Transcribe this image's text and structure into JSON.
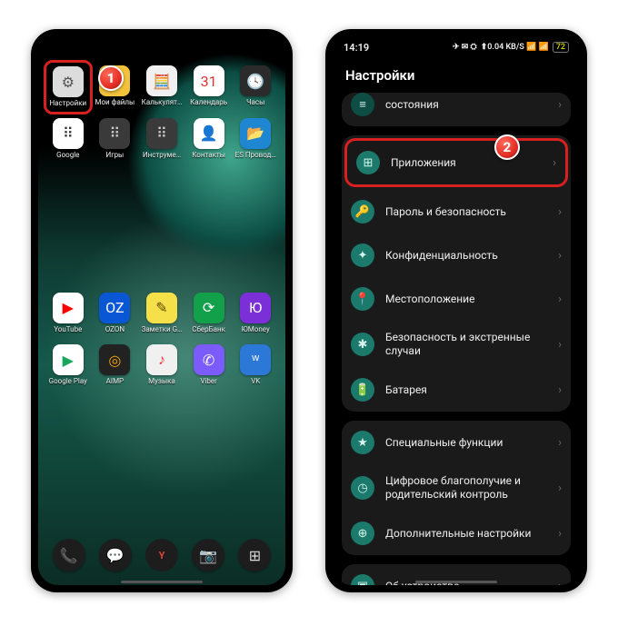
{
  "status": {
    "time": "14:19",
    "battery": "72"
  },
  "badges": {
    "one": "1",
    "two": "2"
  },
  "drawer": {
    "row1": [
      {
        "name": "settings-app",
        "label": "Настройки",
        "icon": "⚙",
        "cls": "ic-gear",
        "hi": true
      },
      {
        "name": "files-app",
        "label": "Мои файлы",
        "icon": "📁",
        "cls": "ic-folder"
      },
      {
        "name": "calculator-app",
        "label": "Калькулят…",
        "icon": "🧮",
        "cls": "ic-calc"
      },
      {
        "name": "calendar-app",
        "label": "Календарь",
        "icon": "31",
        "cls": "ic-cal"
      },
      {
        "name": "clock-app",
        "label": "Часы",
        "icon": "🕓",
        "cls": "ic-clock"
      }
    ],
    "row2": [
      {
        "name": "google-folder",
        "label": "Google",
        "icon": "⠿",
        "cls": "ic-google"
      },
      {
        "name": "games-folder",
        "label": "Игры",
        "icon": "⠿",
        "cls": "ic-games"
      },
      {
        "name": "tools-folder",
        "label": "Инструме…",
        "icon": "⠿",
        "cls": "ic-tools"
      },
      {
        "name": "contacts-app",
        "label": "Контакты",
        "icon": "👤",
        "cls": "ic-contacts"
      },
      {
        "name": "es-explorer-app",
        "label": "ES Провод…",
        "icon": "📂",
        "cls": "ic-es"
      }
    ],
    "row3": [
      {
        "name": "youtube-app",
        "label": "YouTube",
        "icon": "▶",
        "cls": "ic-yt"
      },
      {
        "name": "ozon-app",
        "label": "OZON",
        "icon": "OZ",
        "cls": "ic-ozon"
      },
      {
        "name": "gnotes-app",
        "label": "Заметки G…",
        "icon": "✎",
        "cls": "ic-notes"
      },
      {
        "name": "sberbank-app",
        "label": "СберБанк",
        "icon": "⟳",
        "cls": "ic-sber"
      },
      {
        "name": "yoomoney-app",
        "label": "ЮMoney",
        "icon": "Ю",
        "cls": "ic-yoo"
      }
    ],
    "row4": [
      {
        "name": "google-play-app",
        "label": "Google Play",
        "icon": "▶",
        "cls": "ic-gplay"
      },
      {
        "name": "aimp-app",
        "label": "AIMP",
        "icon": "◎",
        "cls": "ic-aimp"
      },
      {
        "name": "music-app",
        "label": "Музыка",
        "icon": "♪",
        "cls": "ic-music"
      },
      {
        "name": "viber-app",
        "label": "Viber",
        "icon": "✆",
        "cls": "ic-viber"
      },
      {
        "name": "vk-app",
        "label": "VK",
        "icon": "ʷ",
        "cls": "ic-vk"
      }
    ],
    "dock": [
      {
        "name": "dock-phone",
        "icon": "📞",
        "cls": "d-phone"
      },
      {
        "name": "dock-sms",
        "icon": "💬",
        "cls": "d-sms"
      },
      {
        "name": "dock-search",
        "icon": "Y",
        "cls": "d-search",
        "yandex": true
      },
      {
        "name": "dock-camera",
        "icon": "📷",
        "cls": "d-cam"
      },
      {
        "name": "dock-apps",
        "icon": "⊞",
        "cls": "d-apps"
      }
    ]
  },
  "settings": {
    "title": "Настройки",
    "stubLabel": "состояния",
    "groups": [
      [
        {
          "name": "row-apps",
          "icon": "⊞",
          "label": "Приложения",
          "hi": true
        },
        {
          "name": "row-security",
          "icon": "🔑",
          "label": "Пароль и безопасность"
        },
        {
          "name": "row-privacy",
          "icon": "✦",
          "label": "Конфиденциальность"
        },
        {
          "name": "row-location",
          "icon": "📍",
          "label": "Местоположение"
        },
        {
          "name": "row-emergency",
          "icon": "✱",
          "label": "Безопасность и экстренные случаи"
        },
        {
          "name": "row-battery",
          "icon": "🔋",
          "label": "Батарея"
        }
      ],
      [
        {
          "name": "row-special",
          "icon": "★",
          "label": "Специальные функции"
        },
        {
          "name": "row-wellbeing",
          "icon": "◷",
          "label": "Цифровое благополучие и родительский контроль"
        },
        {
          "name": "row-more",
          "icon": "⊕",
          "label": "Дополнительные настройки"
        }
      ],
      [
        {
          "name": "row-about",
          "icon": "▣",
          "label": "Об устройстве"
        }
      ]
    ]
  }
}
